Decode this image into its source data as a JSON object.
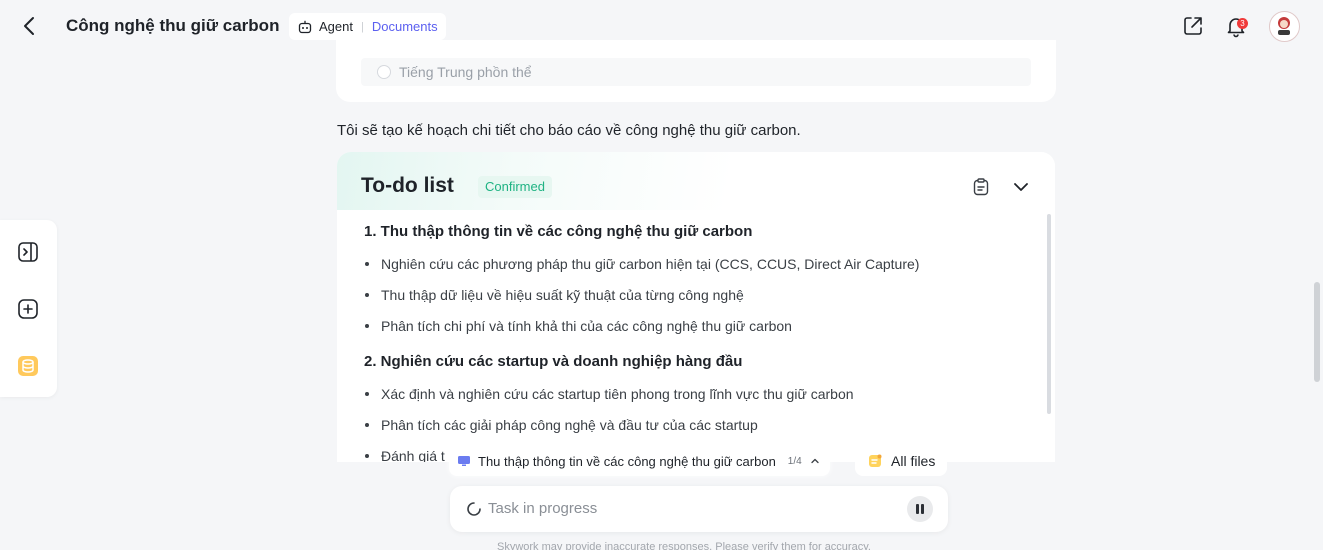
{
  "header": {
    "title": "Công nghệ thu giữ carbon",
    "mode": {
      "agent_label": "Agent",
      "separator": "|",
      "docs_label": "Documents"
    },
    "notification_count": "3",
    "avatar_text": "cartoon"
  },
  "previous": {
    "option_label": "Tiếng Trung phồn thể"
  },
  "assistant_message": "Tôi sẽ tạo kế hoạch chi tiết cho báo cáo về công nghệ thu giữ carbon.",
  "todo": {
    "title": "To-do list",
    "status": "Confirmed",
    "sections": [
      {
        "title": "1. Thu thập thông tin về các công nghệ thu giữ carbon",
        "items": [
          "Nghiên cứu các phương pháp thu giữ carbon hiện tại (CCS, CCUS, Direct Air Capture)",
          "Thu thập dữ liệu về hiệu suất kỹ thuật của từng công nghệ",
          "Phân tích chi phí và tính khả thi của các công nghệ thu giữ carbon"
        ]
      },
      {
        "title": "2. Nghiên cứu các startup và doanh nghiệp hàng đầu",
        "items": [
          "Xác định và nghiên cứu các startup tiên phong trong lĩnh vực thu giữ carbon",
          "Phân tích các giải pháp công nghệ và đầu tư của các startup",
          "Đánh giá t"
        ]
      }
    ]
  },
  "progress": {
    "current_task": "Thu thập thông tin về các công nghệ thu giữ carbon",
    "count": "1/4",
    "files_label": "All files"
  },
  "task_box": {
    "status_text": "Task in progress"
  },
  "disclaimer": "Skywork may provide inaccurate responses. Please verify them for accuracy.",
  "colors": {
    "accent": "#5b5ff0",
    "confirmed": "#1fb383",
    "badge": "#f03a3a"
  }
}
